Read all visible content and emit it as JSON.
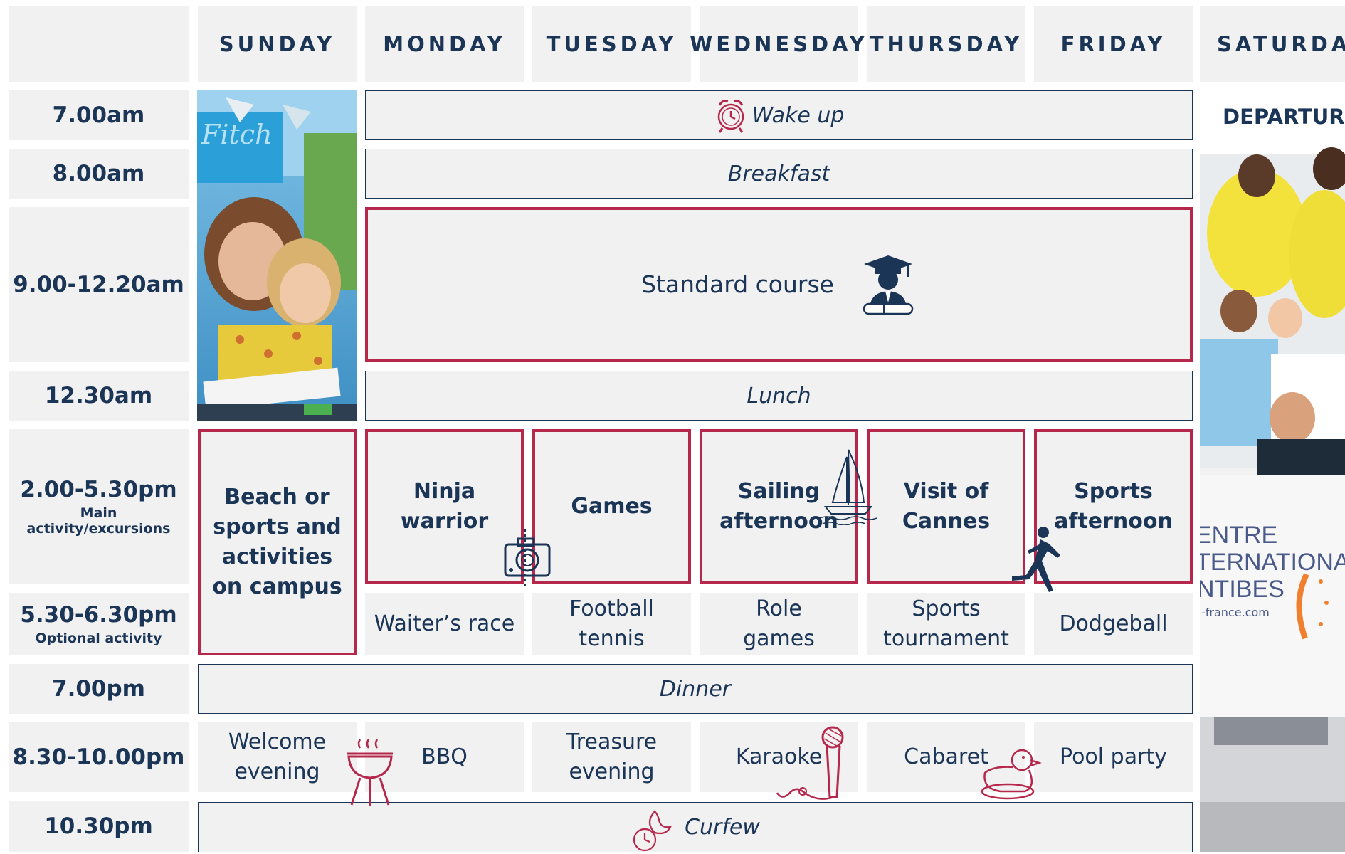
{
  "days": [
    "SUNDAY",
    "MONDAY",
    "TUESDAY",
    "WEDNESDAY",
    "THURSDAY",
    "FRIDAY",
    "SATURDAY"
  ],
  "times": [
    {
      "time": "7.00am",
      "sub": ""
    },
    {
      "time": "8.00am",
      "sub": ""
    },
    {
      "time": "9.00-12.20am",
      "sub": ""
    },
    {
      "time": "12.30am",
      "sub": ""
    },
    {
      "time": "2.00-5.30pm",
      "sub": "Main activity/excursions"
    },
    {
      "time": "5.30-6.30pm",
      "sub": "Optional activity"
    },
    {
      "time": "7.00pm",
      "sub": ""
    },
    {
      "time": "8.30-10.00pm",
      "sub": ""
    },
    {
      "time": "10.30pm",
      "sub": ""
    }
  ],
  "bands": {
    "wake_up": "Wake up",
    "breakfast": "Breakfast",
    "course": "Standard course",
    "lunch": "Lunch",
    "dinner": "Dinner",
    "curfew": "Curfew"
  },
  "sunday_activity": "Beach or sports and activities on campus",
  "afternoon": [
    "Ninja warrior",
    "Games",
    "Sailing afternoon",
    "Visit of Cannes",
    "Sports afternoon"
  ],
  "optional": [
    "Waiter’s race",
    "Football tennis",
    "Role games",
    "Sports tournament",
    "Dodgeball"
  ],
  "evening": [
    "Welcome evening",
    "BBQ",
    "Treasure evening",
    "Karaoke",
    "Cabaret",
    "Pool party"
  ],
  "saturday": {
    "label": "DEPARTURE",
    "sign_lines": [
      "ENTRE",
      "TERNATIONA",
      "NTIBES"
    ],
    "sign_url": "-france.com"
  },
  "colors": {
    "navy": "#1b3557",
    "crimson": "#b5284c",
    "cell": "#f1f1f1"
  },
  "icons": [
    "alarm-clock-icon",
    "graduate-icon",
    "camera-icon",
    "sailboat-icon",
    "runner-icon",
    "bbq-grill-icon",
    "microphone-icon",
    "rubber-duck-icon",
    "moon-clock-icon"
  ]
}
